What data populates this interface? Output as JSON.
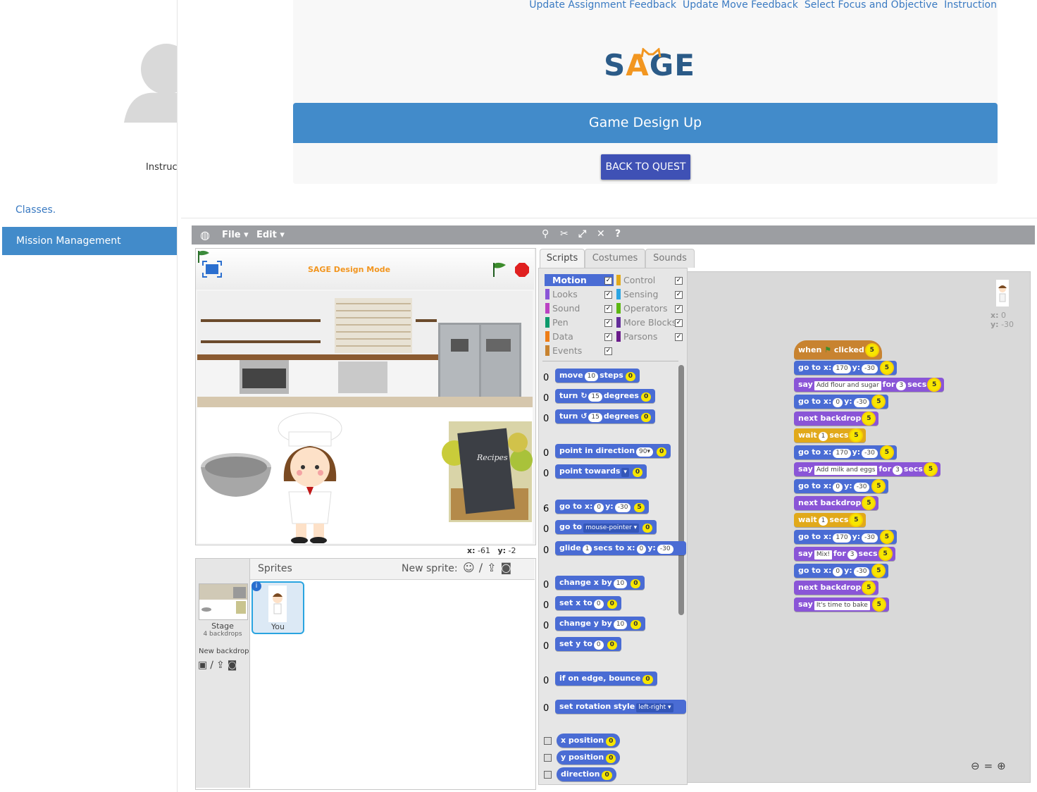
{
  "top_links": [
    "Update Assignment Feedback",
    "Update Move Feedback",
    "Select Focus and Objective",
    "Instruction"
  ],
  "logo": {
    "pre": "S",
    "accent": "A",
    "post": "GE"
  },
  "banner_title": "Game Design Up",
  "back_button": "BACK TO QUEST",
  "sidebar": {
    "instructor": "Instructor",
    "classes": "Classes.",
    "mission": "Mission Management"
  },
  "menu": {
    "file": "File ▾",
    "edit": "Edit ▾"
  },
  "stage": {
    "title": "SAGE Design Mode",
    "x_label": "x:",
    "x": "-61",
    "y_label": "y:",
    "y": "-2"
  },
  "tabs": {
    "scripts": "Scripts",
    "costumes": "Costumes",
    "sounds": "Sounds"
  },
  "categories_left": [
    "Motion",
    "Looks",
    "Sound",
    "Pen",
    "Data",
    "Events"
  ],
  "categories_right": [
    "Control",
    "Sensing",
    "Operators",
    "More Blocks",
    "Parsons"
  ],
  "sprites": {
    "header": "Sprites",
    "new_sprite": "New sprite:",
    "stage_label": "Stage",
    "backdrops": "4 backdrops",
    "new_backdrop": "New backdrop:",
    "sprite_name": "You"
  },
  "palette_counts": [
    "0",
    "0",
    "0",
    "0",
    "0",
    "6",
    "0",
    "0",
    "0",
    "0",
    "0",
    "0",
    "0",
    "0"
  ],
  "palette_blocks": {
    "move": "move",
    "move_val": "10",
    "steps": "steps",
    "turn": "turn",
    "degrees": "degrees",
    "turn_val": "15",
    "point_dir": "point in direction",
    "dir_val": "90▾",
    "point_towards": "point towards",
    "go_to_x": "go to x:",
    "go_x": "0",
    "y_lbl": "y:",
    "go_y": "-30",
    "go_to": "go to",
    "mouse": "mouse-pointer ▾",
    "glide": "glide",
    "glide_val": "1",
    "secs_to_x": "secs to x:",
    "change_x": "change x by",
    "set_x": "set x to",
    "change_y": "change y by",
    "set_y": "set y to",
    "edge": "if on edge, bounce",
    "rot": "set rotation style",
    "rot_val": "left-right ▾",
    "xpos": "x position",
    "ypos": "y position",
    "direction": "direction",
    "zero": "0",
    "ten": "10"
  },
  "sprite_info": {
    "x_label": "x:",
    "x": "0",
    "y_label": "y:",
    "y": "-30"
  },
  "script": {
    "when": "when",
    "clicked": "clicked",
    "star": "5",
    "goto": "go to x:",
    "y": "y:",
    "x170": "170",
    "x0": "0",
    "ym30": "-30",
    "say": "say",
    "for": "for",
    "secs": "secs",
    "three": "3",
    "one": "1",
    "next": "next backdrop",
    "wait": "wait",
    "say1": "Add flour and sugar",
    "say2": "Add milk and eggs",
    "say3": "Mix!",
    "say4": "It's time to bake"
  },
  "colors": {
    "primary": "#428bca",
    "button": "#3f51b5",
    "accent": "#f29620",
    "motion": "#4a6cd4",
    "looks": "#8a55d7",
    "control": "#e1a91a",
    "events": "#c88330"
  }
}
